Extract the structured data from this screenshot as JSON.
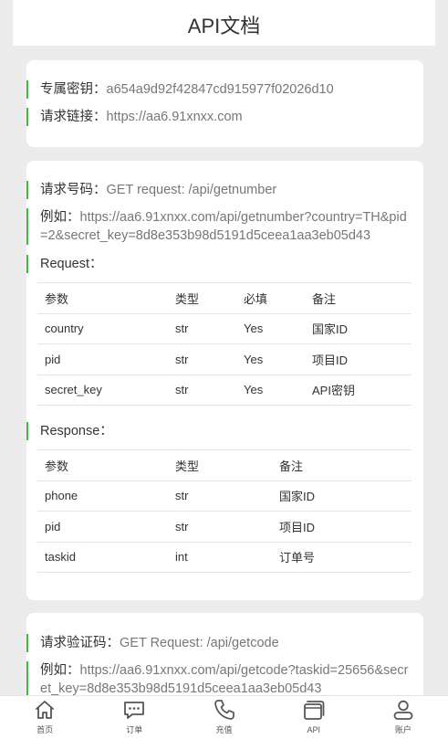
{
  "header": {
    "title": "API文档"
  },
  "info": {
    "key_label": "专属密钥：",
    "key_value": "a654a9d92f42847cd915977f02026d10",
    "url_label": "请求链接：",
    "url_value": "https://aa6.91xnxx.com"
  },
  "getnumber": {
    "req_label": "请求号码：",
    "req_value": "GET request: /api/getnumber",
    "ex_label": "例如：",
    "ex_value": "https://aa6.91xnxx.com/api/getnumber?country=TH&pid=2&secret_key=8d8e353b98d5191d5ceea1aa3eb05d43",
    "request_label": "Request：",
    "request_headers": [
      "参数",
      "类型",
      "必填",
      "备注"
    ],
    "request_rows": [
      [
        "country",
        "str",
        "Yes",
        "国家ID"
      ],
      [
        "pid",
        "str",
        "Yes",
        "项目ID"
      ],
      [
        "secret_key",
        "str",
        "Yes",
        "API密钥"
      ]
    ],
    "response_label": "Response：",
    "response_headers": [
      "参数",
      "类型",
      "备注"
    ],
    "response_rows": [
      [
        "phone",
        "str",
        "国家ID"
      ],
      [
        "pid",
        "str",
        "项目ID"
      ],
      [
        "taskid",
        "int",
        "订单号"
      ]
    ]
  },
  "getcode": {
    "req_label": "请求验证码：",
    "req_value": "GET Request: /api/getcode",
    "ex_label": "例如：",
    "ex_value": "https://aa6.91xnxx.com/api/getcode?taskid=25656&secret_key=8d8e353b98d5191d5ceea1aa3eb05d43"
  },
  "tabbar": {
    "items": [
      {
        "label": "首页",
        "icon": "home-icon"
      },
      {
        "label": "订单",
        "icon": "chat-icon"
      },
      {
        "label": "充值",
        "icon": "phone-icon"
      },
      {
        "label": "API",
        "icon": "cards-icon"
      },
      {
        "label": "账户",
        "icon": "user-icon"
      }
    ]
  },
  "colors": {
    "accent": "#3bbf3b",
    "background": "#ececec"
  }
}
